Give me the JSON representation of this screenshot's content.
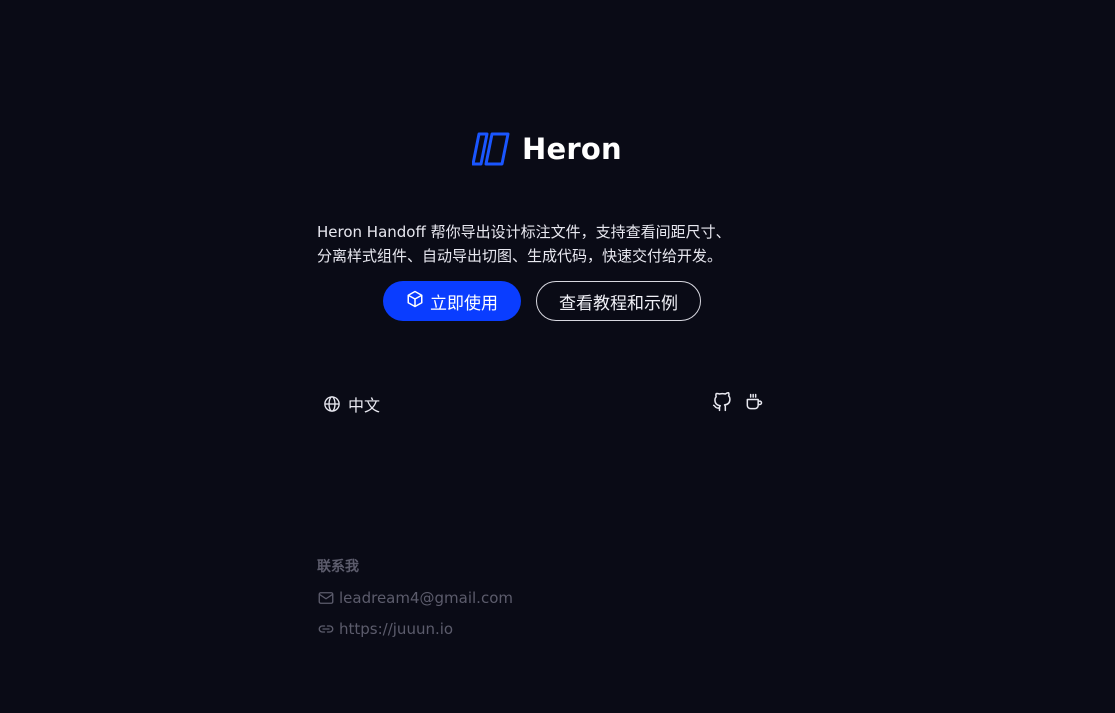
{
  "brand": {
    "name": "Heron",
    "logo_icon": "heron-logo-icon",
    "accent_color": "#1a56ff"
  },
  "description": {
    "line1": "Heron Handoff 帮你导出设计标注文件，支持查看间距尺寸、",
    "line2": "分离样式组件、自动导出切图、生成代码，快速交付给开发。"
  },
  "actions": {
    "primary_label": "立即使用",
    "primary_icon": "cube-icon",
    "primary_color": "#0a3dff",
    "secondary_label": "查看教程和示例"
  },
  "language": {
    "icon": "globe-icon",
    "label": "中文"
  },
  "social": {
    "icons": [
      "github-icon",
      "coffee-icon"
    ]
  },
  "contact": {
    "title": "联系我",
    "email_icon": "mail-icon",
    "email": "leadream4@gmail.com",
    "link_icon": "link-icon",
    "website": "https://juuun.io"
  },
  "colors": {
    "background": "#0a0b16",
    "muted_text": "#5c5c6c"
  }
}
